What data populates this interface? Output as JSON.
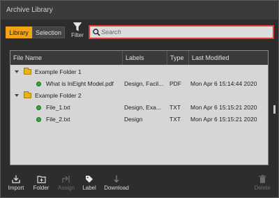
{
  "window": {
    "title": "Archive Library"
  },
  "toolbar": {
    "library_label": "Library",
    "selection_label": "Selection",
    "filter_label": "Filter"
  },
  "search": {
    "placeholder": "Search",
    "value": ""
  },
  "table": {
    "columns": [
      "File Name",
      "Labels",
      "Type",
      "Last Modified"
    ],
    "rows": [
      {
        "kind": "folder",
        "name": "Example Folder 1",
        "labels": "",
        "type": "",
        "modified": ""
      },
      {
        "kind": "file",
        "name": "What is InEight Model.pdf",
        "labels": "Design, Facil...",
        "type": "PDF",
        "modified": "Mon Apr 6 15:14:44 2020"
      },
      {
        "kind": "folder",
        "name": "Example Folder 2",
        "labels": "",
        "type": "",
        "modified": ""
      },
      {
        "kind": "file",
        "name": "File_1.txt",
        "labels": "Design, Exa...",
        "type": "TXT",
        "modified": "Mon Apr 6 15:15:21 2020"
      },
      {
        "kind": "file",
        "name": "File_2.txt",
        "labels": "Design",
        "type": "TXT",
        "modified": "Mon Apr 6 15:15:21 2020"
      }
    ]
  },
  "bottombar": {
    "import_label": "Import",
    "folder_label": "Folder",
    "assign_label": "Assign",
    "label_label": "Label",
    "download_label": "Download",
    "delete_label": "Delete"
  },
  "colors": {
    "accent": "#f2a417",
    "search_border": "#e53a3a",
    "status_green": "#2fa83a",
    "folder_yellow": "#e6b418"
  }
}
